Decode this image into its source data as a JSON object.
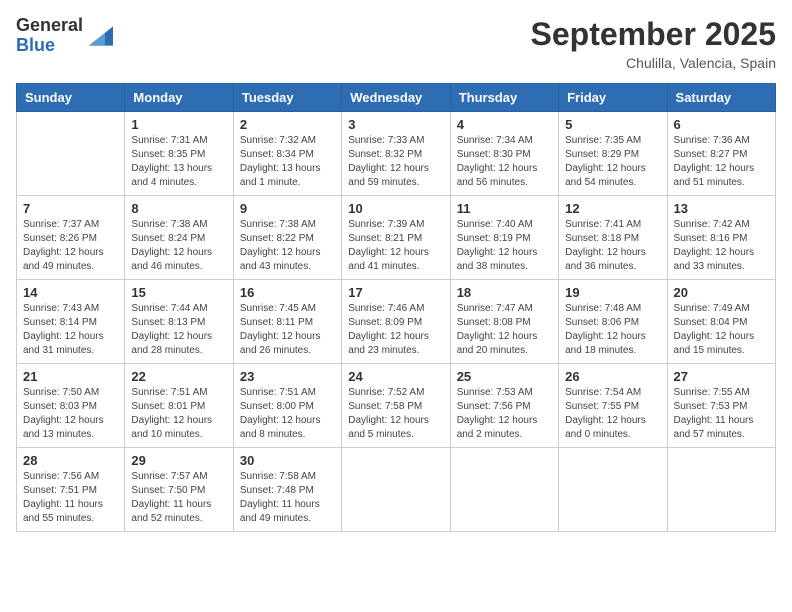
{
  "logo": {
    "general": "General",
    "blue": "Blue"
  },
  "header": {
    "month_year": "September 2025",
    "location": "Chulilla, Valencia, Spain"
  },
  "weekdays": [
    "Sunday",
    "Monday",
    "Tuesday",
    "Wednesday",
    "Thursday",
    "Friday",
    "Saturday"
  ],
  "weeks": [
    [
      {
        "day": "",
        "sunrise": "",
        "sunset": "",
        "daylight": ""
      },
      {
        "day": "1",
        "sunrise": "Sunrise: 7:31 AM",
        "sunset": "Sunset: 8:35 PM",
        "daylight": "Daylight: 13 hours and 4 minutes."
      },
      {
        "day": "2",
        "sunrise": "Sunrise: 7:32 AM",
        "sunset": "Sunset: 8:34 PM",
        "daylight": "Daylight: 13 hours and 1 minute."
      },
      {
        "day": "3",
        "sunrise": "Sunrise: 7:33 AM",
        "sunset": "Sunset: 8:32 PM",
        "daylight": "Daylight: 12 hours and 59 minutes."
      },
      {
        "day": "4",
        "sunrise": "Sunrise: 7:34 AM",
        "sunset": "Sunset: 8:30 PM",
        "daylight": "Daylight: 12 hours and 56 minutes."
      },
      {
        "day": "5",
        "sunrise": "Sunrise: 7:35 AM",
        "sunset": "Sunset: 8:29 PM",
        "daylight": "Daylight: 12 hours and 54 minutes."
      },
      {
        "day": "6",
        "sunrise": "Sunrise: 7:36 AM",
        "sunset": "Sunset: 8:27 PM",
        "daylight": "Daylight: 12 hours and 51 minutes."
      }
    ],
    [
      {
        "day": "7",
        "sunrise": "Sunrise: 7:37 AM",
        "sunset": "Sunset: 8:26 PM",
        "daylight": "Daylight: 12 hours and 49 minutes."
      },
      {
        "day": "8",
        "sunrise": "Sunrise: 7:38 AM",
        "sunset": "Sunset: 8:24 PM",
        "daylight": "Daylight: 12 hours and 46 minutes."
      },
      {
        "day": "9",
        "sunrise": "Sunrise: 7:38 AM",
        "sunset": "Sunset: 8:22 PM",
        "daylight": "Daylight: 12 hours and 43 minutes."
      },
      {
        "day": "10",
        "sunrise": "Sunrise: 7:39 AM",
        "sunset": "Sunset: 8:21 PM",
        "daylight": "Daylight: 12 hours and 41 minutes."
      },
      {
        "day": "11",
        "sunrise": "Sunrise: 7:40 AM",
        "sunset": "Sunset: 8:19 PM",
        "daylight": "Daylight: 12 hours and 38 minutes."
      },
      {
        "day": "12",
        "sunrise": "Sunrise: 7:41 AM",
        "sunset": "Sunset: 8:18 PM",
        "daylight": "Daylight: 12 hours and 36 minutes."
      },
      {
        "day": "13",
        "sunrise": "Sunrise: 7:42 AM",
        "sunset": "Sunset: 8:16 PM",
        "daylight": "Daylight: 12 hours and 33 minutes."
      }
    ],
    [
      {
        "day": "14",
        "sunrise": "Sunrise: 7:43 AM",
        "sunset": "Sunset: 8:14 PM",
        "daylight": "Daylight: 12 hours and 31 minutes."
      },
      {
        "day": "15",
        "sunrise": "Sunrise: 7:44 AM",
        "sunset": "Sunset: 8:13 PM",
        "daylight": "Daylight: 12 hours and 28 minutes."
      },
      {
        "day": "16",
        "sunrise": "Sunrise: 7:45 AM",
        "sunset": "Sunset: 8:11 PM",
        "daylight": "Daylight: 12 hours and 26 minutes."
      },
      {
        "day": "17",
        "sunrise": "Sunrise: 7:46 AM",
        "sunset": "Sunset: 8:09 PM",
        "daylight": "Daylight: 12 hours and 23 minutes."
      },
      {
        "day": "18",
        "sunrise": "Sunrise: 7:47 AM",
        "sunset": "Sunset: 8:08 PM",
        "daylight": "Daylight: 12 hours and 20 minutes."
      },
      {
        "day": "19",
        "sunrise": "Sunrise: 7:48 AM",
        "sunset": "Sunset: 8:06 PM",
        "daylight": "Daylight: 12 hours and 18 minutes."
      },
      {
        "day": "20",
        "sunrise": "Sunrise: 7:49 AM",
        "sunset": "Sunset: 8:04 PM",
        "daylight": "Daylight: 12 hours and 15 minutes."
      }
    ],
    [
      {
        "day": "21",
        "sunrise": "Sunrise: 7:50 AM",
        "sunset": "Sunset: 8:03 PM",
        "daylight": "Daylight: 12 hours and 13 minutes."
      },
      {
        "day": "22",
        "sunrise": "Sunrise: 7:51 AM",
        "sunset": "Sunset: 8:01 PM",
        "daylight": "Daylight: 12 hours and 10 minutes."
      },
      {
        "day": "23",
        "sunrise": "Sunrise: 7:51 AM",
        "sunset": "Sunset: 8:00 PM",
        "daylight": "Daylight: 12 hours and 8 minutes."
      },
      {
        "day": "24",
        "sunrise": "Sunrise: 7:52 AM",
        "sunset": "Sunset: 7:58 PM",
        "daylight": "Daylight: 12 hours and 5 minutes."
      },
      {
        "day": "25",
        "sunrise": "Sunrise: 7:53 AM",
        "sunset": "Sunset: 7:56 PM",
        "daylight": "Daylight: 12 hours and 2 minutes."
      },
      {
        "day": "26",
        "sunrise": "Sunrise: 7:54 AM",
        "sunset": "Sunset: 7:55 PM",
        "daylight": "Daylight: 12 hours and 0 minutes."
      },
      {
        "day": "27",
        "sunrise": "Sunrise: 7:55 AM",
        "sunset": "Sunset: 7:53 PM",
        "daylight": "Daylight: 11 hours and 57 minutes."
      }
    ],
    [
      {
        "day": "28",
        "sunrise": "Sunrise: 7:56 AM",
        "sunset": "Sunset: 7:51 PM",
        "daylight": "Daylight: 11 hours and 55 minutes."
      },
      {
        "day": "29",
        "sunrise": "Sunrise: 7:57 AM",
        "sunset": "Sunset: 7:50 PM",
        "daylight": "Daylight: 11 hours and 52 minutes."
      },
      {
        "day": "30",
        "sunrise": "Sunrise: 7:58 AM",
        "sunset": "Sunset: 7:48 PM",
        "daylight": "Daylight: 11 hours and 49 minutes."
      },
      {
        "day": "",
        "sunrise": "",
        "sunset": "",
        "daylight": ""
      },
      {
        "day": "",
        "sunrise": "",
        "sunset": "",
        "daylight": ""
      },
      {
        "day": "",
        "sunrise": "",
        "sunset": "",
        "daylight": ""
      },
      {
        "day": "",
        "sunrise": "",
        "sunset": "",
        "daylight": ""
      }
    ]
  ]
}
